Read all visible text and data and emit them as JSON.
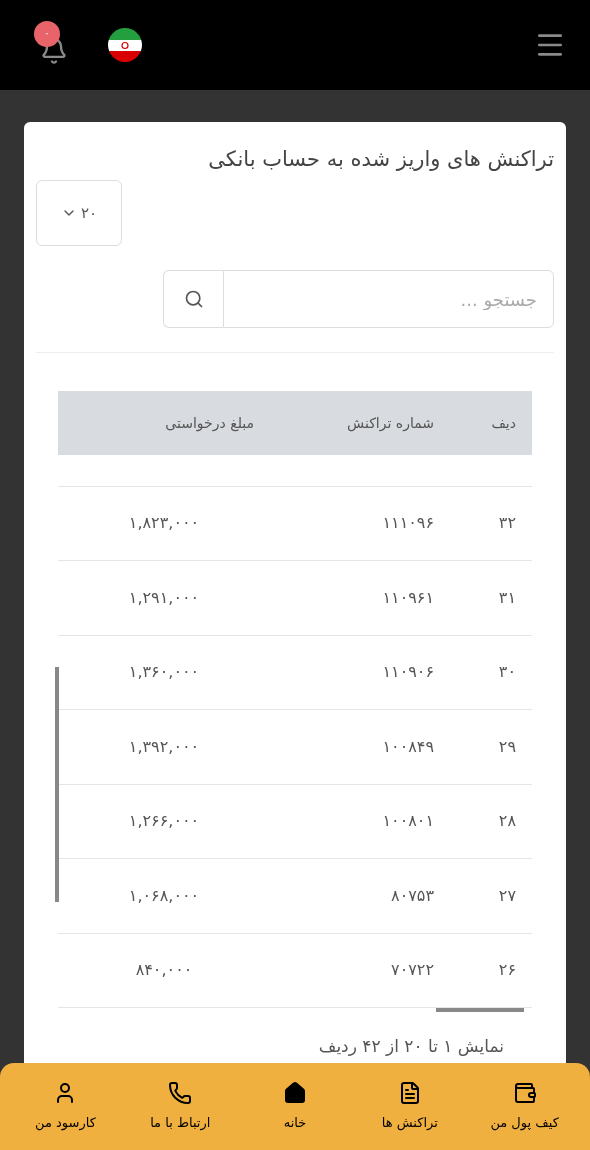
{
  "header": {
    "notification_count": "۰"
  },
  "card": {
    "title": "تراکنش های واریز شده به حساب بانکی",
    "page_size": "۲۰",
    "search": {
      "placeholder": "جستجو ..."
    },
    "table": {
      "columns": [
        "دیف",
        "شماره تراکنش",
        "مبلغ درخواستی"
      ],
      "rows": [
        [
          "۳۲",
          "۱۱۱۰۹۶",
          "۱,۸۲۳,۰۰۰"
        ],
        [
          "۳۱",
          "۱۱۰۹۶۱",
          "۱,۲۹۱,۰۰۰"
        ],
        [
          "۳۰",
          "۱۱۰۹۰۶",
          "۱,۳۶۰,۰۰۰"
        ],
        [
          "۲۹",
          "۱۰۰۸۴۹",
          "۱,۳۹۲,۰۰۰"
        ],
        [
          "۲۸",
          "۱۰۰۸۰۱",
          "۱,۲۶۶,۰۰۰"
        ],
        [
          "۲۷",
          "۸۰۷۵۳",
          "۱,۰۶۸,۰۰۰"
        ],
        [
          "۲۶",
          "۷۰۷۲۲",
          "۸۴۰,۰۰۰"
        ]
      ]
    },
    "footer": "نمایش ۱ تا ۲۰ از ۴۲ ردیف"
  },
  "bottom_nav": [
    {
      "label": "کیف پول من"
    },
    {
      "label": "تراکنش ها"
    },
    {
      "label": "خانه"
    },
    {
      "label": "ارتباط با ما"
    },
    {
      "label": "کارسود من"
    }
  ]
}
